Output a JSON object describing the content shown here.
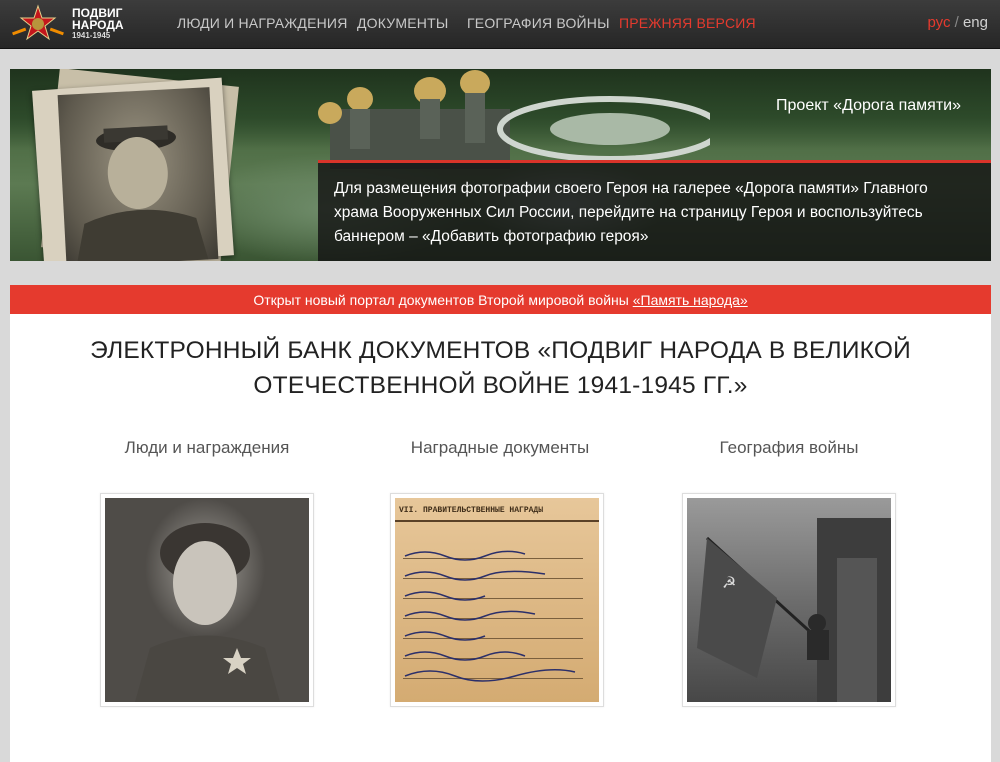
{
  "header": {
    "logo": {
      "line1": "ПОДВИГ",
      "line2": "НАРОДА",
      "years": "1941-1945"
    },
    "nav": [
      {
        "label": "ЛЮДИ И НАГРАЖДЕНИЯ",
        "color": "#c8c8c8"
      },
      {
        "label": "ДОКУМЕНТЫ",
        "color": "#c8c8c8"
      },
      {
        "label": "ГЕОГРАФИЯ ВОЙНЫ",
        "color": "#c8c8c8"
      },
      {
        "label": "ПРЕЖНЯЯ ВЕРСИЯ",
        "color": "#e53a2e"
      }
    ],
    "lang": {
      "active": "рус",
      "separator": "/",
      "other": "eng"
    }
  },
  "banner": {
    "title": "Проект «Дорога памяти»",
    "text": "Для размещения фотографии своего Героя на галерее «Дорога памяти» Главного храма Вооруженных Сил России, перейдите на страницу Героя и воспользуйтесь баннером – «Добавить фотографию героя»"
  },
  "notice": {
    "text": "Открыт новый портал документов Второй мировой войны ",
    "link": "«Память народа»"
  },
  "main": {
    "headline_line1": "ЭЛЕКТРОННЫЙ БАНК ДОКУМЕНТОВ «ПОДВИГ НАРОДА В ВЕЛИКОЙ",
    "headline_line2": "ОТЕЧЕСТВЕННОЙ ВОЙНЕ 1941-1945 ГГ.»",
    "sections": [
      {
        "label": "Люди и награждения"
      },
      {
        "label": "Наградные документы"
      },
      {
        "label": "География войны"
      }
    ],
    "doc_header": "VII. ПРАВИТЕЛЬСТВЕННЫЕ НАГРАДЫ"
  },
  "colors": {
    "accent": "#e53a2e",
    "topbar": "#2e2e2e",
    "page_bg": "#d9d9d9"
  }
}
